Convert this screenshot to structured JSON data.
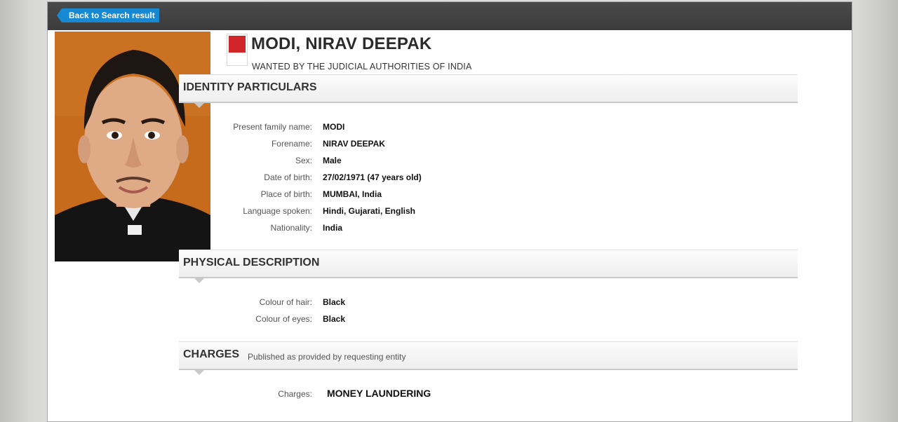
{
  "nav": {
    "back_label": "Back to Search result"
  },
  "person": {
    "name": "MODI, NIRAV DEEPAK",
    "wanted_by": "WANTED BY THE JUDICIAL AUTHORITIES OF INDIA"
  },
  "identity": {
    "title": "IDENTITY PARTICULARS",
    "fields": [
      {
        "label": "Present family name:",
        "value": "MODI"
      },
      {
        "label": "Forename:",
        "value": "NIRAV DEEPAK"
      },
      {
        "label": "Sex:",
        "value": "Male"
      },
      {
        "label": "Date of birth:",
        "value": "27/02/1971 (47 years old)"
      },
      {
        "label": "Place of birth:",
        "value": "MUMBAI, India"
      },
      {
        "label": "Language spoken:",
        "value": "Hindi, Gujarati, English"
      },
      {
        "label": "Nationality:",
        "value": "India"
      }
    ]
  },
  "physical": {
    "title": "PHYSICAL DESCRIPTION",
    "fields": [
      {
        "label": "Colour of hair:",
        "value": "Black"
      },
      {
        "label": "Colour of eyes:",
        "value": "Black"
      }
    ]
  },
  "charges": {
    "title": "CHARGES",
    "subtitle": "Published as provided by requesting entity",
    "label": "Charges:",
    "value": "MONEY LAUNDERING"
  },
  "colors": {
    "accent": "#1689d2",
    "seal": "#d0262a",
    "topbar": "#3b3b3b"
  },
  "icons": {
    "back": "arrow-left-icon",
    "seal": "emblem-icon"
  }
}
